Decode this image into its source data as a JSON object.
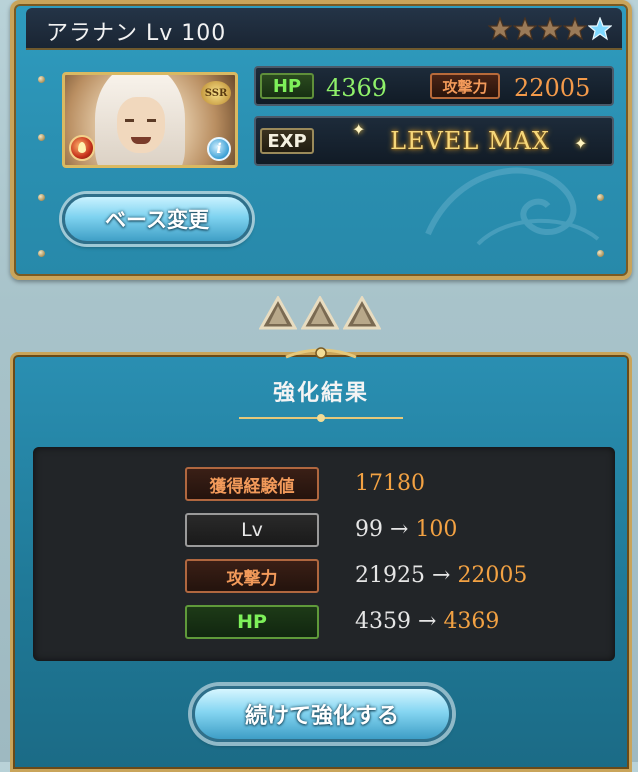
{
  "character": {
    "name_level": "アラナン Lv 100",
    "rarity_badge": "SSR",
    "info_icon": "i",
    "element_icon": "fire-element-icon",
    "stars": [
      {
        "type": "bronze"
      },
      {
        "type": "bronze"
      },
      {
        "type": "bronze"
      },
      {
        "type": "bronze"
      },
      {
        "type": "blue"
      }
    ]
  },
  "stats": {
    "hp_label": "HP",
    "hp_value": "4369",
    "atk_label": "攻撃力",
    "atk_value": "22005",
    "exp_label": "EXP",
    "exp_value": "LEVEL MAX"
  },
  "base_button": {
    "label": "ベース変更"
  },
  "result": {
    "title": "強化結果",
    "rows": [
      {
        "label": "獲得経験値",
        "style": "brown",
        "before": "",
        "arrow": "",
        "after": "17180"
      },
      {
        "label": "Lv",
        "style": "gray",
        "before": "99",
        "arrow": "→",
        "after": "100"
      },
      {
        "label": "攻撃力",
        "style": "brown",
        "before": "21925",
        "arrow": "→",
        "after": "22005"
      },
      {
        "label": "HP",
        "style": "green",
        "before": "4359",
        "arrow": "→",
        "after": "4369"
      }
    ]
  },
  "continue_button": {
    "label": "続けて強化する"
  },
  "colors": {
    "panel_blue": "#2a8fb1",
    "gold_border": "#c9a45a",
    "hp_green": "#8ff06a",
    "atk_orange": "#f39a4a",
    "result_orange": "#f3a243"
  }
}
